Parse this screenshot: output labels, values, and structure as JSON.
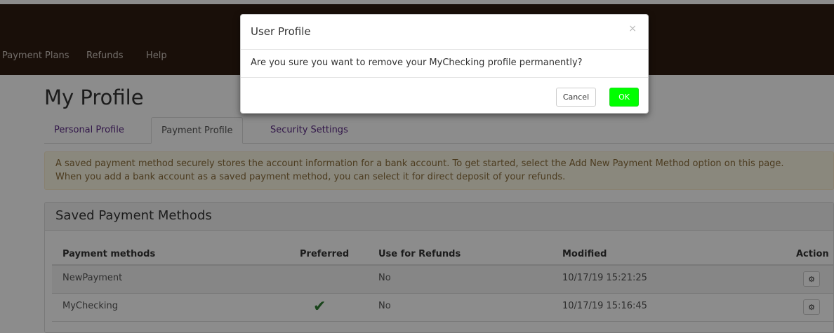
{
  "nav": {
    "items": [
      "Payment Plans",
      "Refunds",
      "Help"
    ]
  },
  "page": {
    "title": "My Profile",
    "tabs": [
      "Personal Profile",
      "Payment Profile",
      "Security Settings"
    ],
    "active_tab": "Payment Profile",
    "alert_lines": [
      "A saved payment method securely stores the account information for a bank account. To get started, select the Add New Payment Method option on this page.",
      "When you add a bank account as a saved payment method, you can select it for direct deposit of your refunds."
    ]
  },
  "panel": {
    "heading": "Saved Payment Methods",
    "columns": [
      "Payment methods",
      "Preferred",
      "Use for Refunds",
      "Modified",
      "Action"
    ],
    "rows": [
      {
        "method": "NewPayment",
        "preferred": false,
        "refunds": "No",
        "modified": "10/17/19 15:21:25"
      },
      {
        "method": "MyChecking",
        "preferred": true,
        "refunds": "No",
        "modified": "10/17/19 15:16:45"
      }
    ]
  },
  "modal": {
    "title": "User Profile",
    "close": "×",
    "message": "Are you sure you want to remove your MyChecking profile permanently?",
    "cancel_label": "Cancel",
    "ok_label": "OK"
  },
  "icons": {
    "check": "check-icon",
    "gear": "gear-icon",
    "close": "close-icon"
  },
  "colors": {
    "navbar": "#2f1c12",
    "tab_link": "#5b2a86",
    "ok_button": "#00ff00",
    "check": "#2e7d32",
    "alert_bg": "#fcf8e3"
  }
}
